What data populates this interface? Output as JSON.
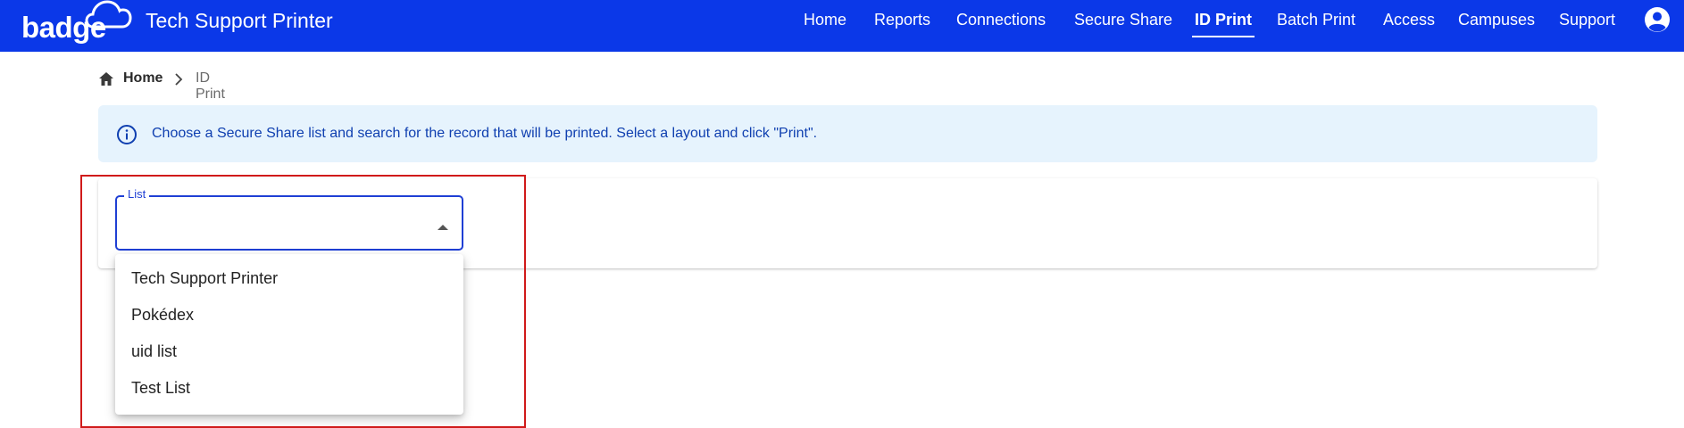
{
  "header": {
    "logo_text": "badge",
    "app_title": "Tech Support Printer",
    "nav": [
      {
        "label": "Home"
      },
      {
        "label": "Reports"
      },
      {
        "label": "Connections"
      },
      {
        "label": "Secure Share"
      },
      {
        "label": "ID Print"
      },
      {
        "label": "Batch Print"
      },
      {
        "label": "Access"
      },
      {
        "label": "Campuses"
      },
      {
        "label": "Support"
      }
    ],
    "active_nav": "ID Print",
    "account_icon": "account-circle-icon"
  },
  "breadcrumb": {
    "home_icon": "home-icon",
    "home_label": "Home",
    "separator_icon": "chevron-right-icon",
    "current": "ID Print"
  },
  "info_banner": {
    "icon": "info-circle-icon",
    "text": "Choose a Secure Share list and search for the record that will be printed. Select a layout and click \"Print\"."
  },
  "list_select": {
    "label": "List",
    "value": "",
    "arrow_icon": "caret-up-icon",
    "options": [
      "Tech Support Printer",
      "Pokédex",
      "uid list",
      "Test List"
    ]
  },
  "colors": {
    "brand": "#0b38e8",
    "info_background": "#e6f3fd",
    "info_text": "#0f3fb0",
    "focus": "#1f3fd4",
    "highlight": "#d01a1a"
  }
}
